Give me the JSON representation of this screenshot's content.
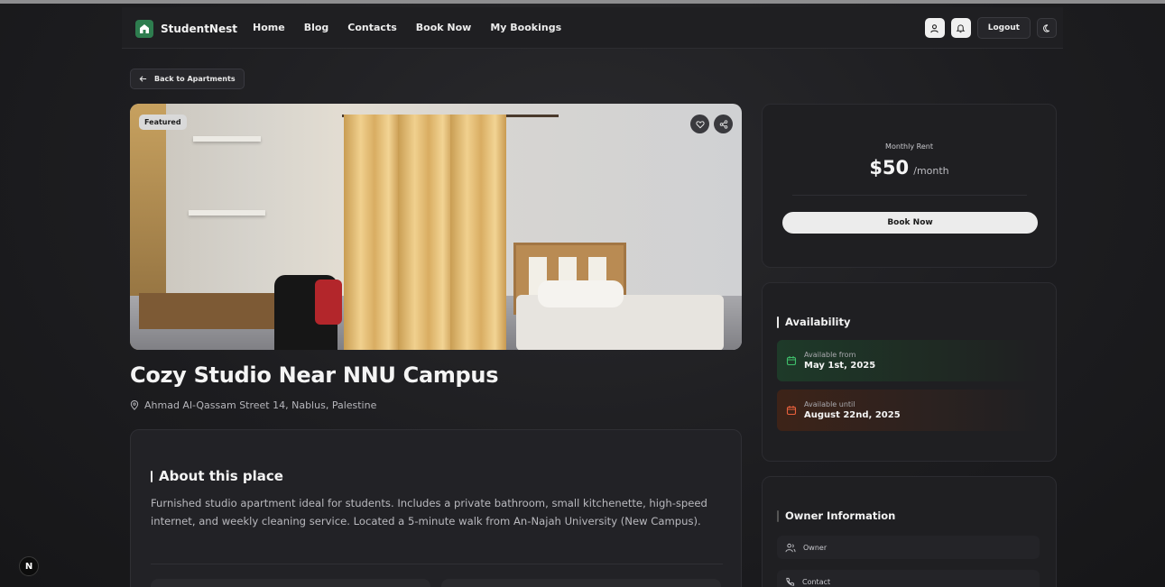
{
  "nav": {
    "brand": "StudentNest",
    "links": [
      "Home",
      "Blog",
      "Contacts",
      "Book Now",
      "My Bookings"
    ],
    "logout_label": "Logout"
  },
  "back_label": "Back to Apartments",
  "listing": {
    "badge": "Featured",
    "title": "Cozy Studio Near NNU Campus",
    "address": "Ahmad Al-Qassam Street 14, Nablus, Palestine",
    "about_title": "About this place",
    "about_text": "Furnished studio apartment ideal for students. Includes a private bathroom, small kitchenette, high-speed internet, and weekly cleaning service. Located a 5-minute walk from An-Najah University (New Campus)."
  },
  "pricing": {
    "label": "Monthly Rent",
    "amount": "$50",
    "unit": "/month",
    "book_label": "Book Now"
  },
  "availability": {
    "title": "Availability",
    "from_label": "Available from",
    "from_date": "May 1st, 2025",
    "until_label": "Available until",
    "until_date": "August 22nd, 2025"
  },
  "owner": {
    "title": "Owner Information",
    "owner_label": "Owner",
    "contact_label": "Contact"
  },
  "dev_badge": "N",
  "colors": {
    "background": "#1b1b1d",
    "brand_green": "#2e7d4f",
    "available_green": "#3fbf6b",
    "available_orange": "#e8603c"
  },
  "icons": [
    "home-icon",
    "user-icon",
    "bell-icon",
    "moon-icon",
    "arrow-left-icon",
    "heart-icon",
    "share-icon",
    "location-pin-icon",
    "calendar-icon",
    "users-icon",
    "phone-icon"
  ]
}
